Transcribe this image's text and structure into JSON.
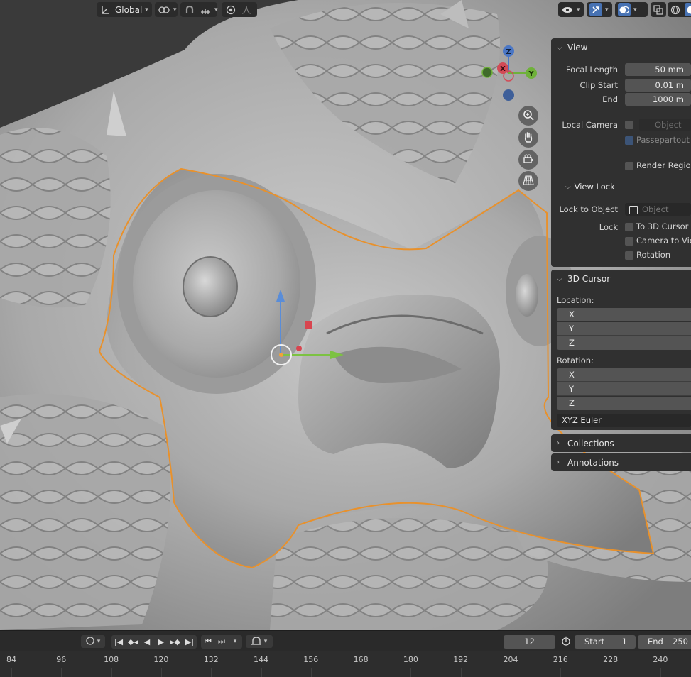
{
  "header": {
    "orientation_label": "Global",
    "icons": [
      "transform-orientation-icon",
      "pivot-icon",
      "snap-icon",
      "snap-increment-icon",
      "proportional-edit-icon",
      "falloff-icon",
      "visibility-icon",
      "gizmo-icon",
      "overlay-icon",
      "xray-icon",
      "wireframe-shading-icon",
      "solid-shading-icon"
    ]
  },
  "gizmo": {
    "x": "X",
    "y": "Y",
    "z": "Z"
  },
  "npanel": {
    "view": {
      "title": "View",
      "focal_length_label": "Focal Length",
      "focal_length_value": "50 mm",
      "clip_start_label": "Clip Start",
      "clip_start_value": "0.01 m",
      "clip_end_label": "End",
      "clip_end_value": "1000 m",
      "local_camera_label": "Local Camera",
      "local_camera_placeholder": "Object",
      "passepartout_label": "Passepartout",
      "render_region_label": "Render Region",
      "view_lock_title": "View Lock",
      "lock_to_object_label": "Lock to Object",
      "lock_to_object_placeholder": "Object",
      "lock_label": "Lock",
      "to_3d_cursor_label": "To 3D Cursor",
      "camera_to_view_label": "Camera to View",
      "rotation_label": "Rotation"
    },
    "cursor": {
      "title": "3D Cursor",
      "location_label": "Location:",
      "loc_x": "X",
      "loc_y": "Y",
      "loc_z": "Z",
      "rotation_label": "Rotation:",
      "rot_x": "X",
      "rot_y": "Y",
      "rot_z": "Z",
      "rotation_mode": "XYZ Euler"
    },
    "collections_title": "Collections",
    "annotations_title": "Annotations"
  },
  "timeline": {
    "current_frame": "12",
    "start_label": "Start",
    "start_value": "1",
    "end_label": "End",
    "end_value": "250",
    "ticks": [
      "84",
      "96",
      "108",
      "120",
      "132",
      "144",
      "156",
      "168",
      "180",
      "192",
      "204",
      "216",
      "228",
      "240"
    ]
  }
}
